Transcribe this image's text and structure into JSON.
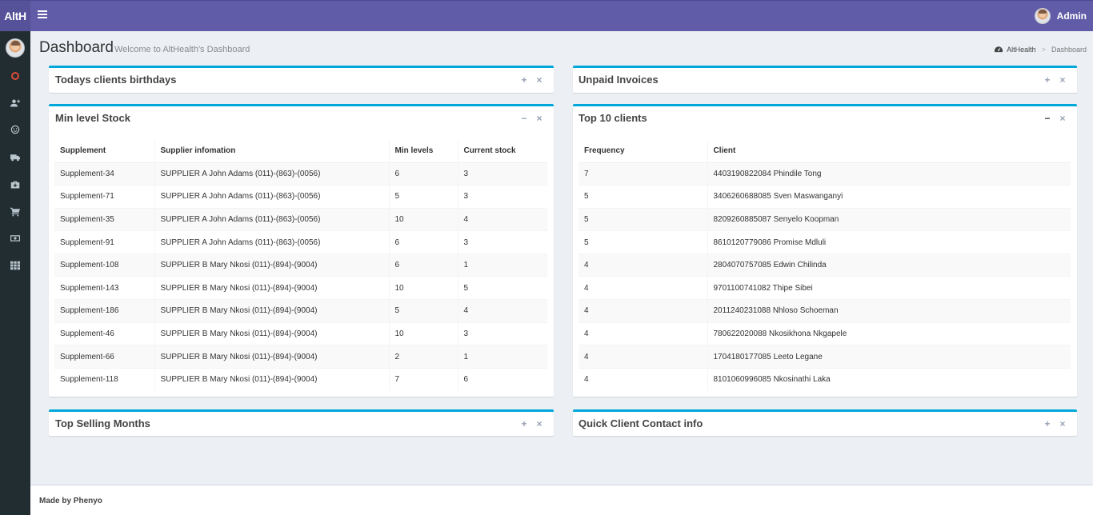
{
  "app": {
    "logo": "AltH",
    "user_name": "Admin"
  },
  "header": {
    "title": "Dashboard",
    "subtitle": "Welcome to AltHealth's Dashboard",
    "breadcrumb": {
      "home": "AltHealth",
      "current": "Dashboard"
    }
  },
  "sidebar": {
    "icons": [
      "circle-icon",
      "add-user-icon",
      "smile-icon",
      "truck-icon",
      "medkit-icon",
      "cart-icon",
      "money-icon",
      "grid-icon"
    ]
  },
  "boxes": {
    "birthdays": {
      "title": "Todays clients birthdays",
      "tool_expand": "+",
      "tool_close": "×"
    },
    "invoices": {
      "title": "Unpaid Invoices",
      "tool_expand": "+",
      "tool_close": "×"
    },
    "min_stock": {
      "title": "Min level Stock",
      "tool_collapse": "−",
      "tool_close": "×",
      "columns": [
        "Supplement",
        "Supplier infomation",
        "Min levels",
        "Current stock"
      ],
      "rows": [
        [
          "Supplement-34",
          "SUPPLIER A John Adams (011)-(863)-(0056)",
          "6",
          "3"
        ],
        [
          "Supplement-71",
          "SUPPLIER A John Adams (011)-(863)-(0056)",
          "5",
          "3"
        ],
        [
          "Supplement-35",
          "SUPPLIER A John Adams (011)-(863)-(0056)",
          "10",
          "4"
        ],
        [
          "Supplement-91",
          "SUPPLIER A John Adams (011)-(863)-(0056)",
          "6",
          "3"
        ],
        [
          "Supplement-108",
          "SUPPLIER B Mary Nkosi (011)-(894)-(9004)",
          "6",
          "1"
        ],
        [
          "Supplement-143",
          "SUPPLIER B Mary Nkosi (011)-(894)-(9004)",
          "10",
          "5"
        ],
        [
          "Supplement-186",
          "SUPPLIER B Mary Nkosi (011)-(894)-(9004)",
          "5",
          "4"
        ],
        [
          "Supplement-46",
          "SUPPLIER B Mary Nkosi (011)-(894)-(9004)",
          "10",
          "3"
        ],
        [
          "Supplement-66",
          "SUPPLIER B Mary Nkosi (011)-(894)-(9004)",
          "2",
          "1"
        ],
        [
          "Supplement-118",
          "SUPPLIER B Mary Nkosi (011)-(894)-(9004)",
          "7",
          "6"
        ]
      ]
    },
    "top_clients": {
      "title": "Top 10 clients",
      "tool_collapse": "−",
      "tool_close": "×",
      "columns": [
        "Frequency",
        "Client"
      ],
      "rows": [
        [
          "7",
          "4403190822084 Phindile Tong"
        ],
        [
          "5",
          "3406260688085 Sven Maswanganyi"
        ],
        [
          "5",
          "8209260885087 Senyelo Koopman"
        ],
        [
          "5",
          "8610120779086 Promise Mdluli"
        ],
        [
          "4",
          "2804070757085 Edwin Chilinda"
        ],
        [
          "4",
          "9701100741082 Thipe Sibei"
        ],
        [
          "4",
          "2011240231088 Nhloso Schoeman"
        ],
        [
          "4",
          "780622020088 Nkosikhona Nkgapele"
        ],
        [
          "4",
          "1704180177085 Leeto Legane"
        ],
        [
          "4",
          "8101060996085 Nkosinathi Laka"
        ]
      ]
    },
    "selling_months": {
      "title": "Top Selling Months",
      "tool_expand": "+",
      "tool_close": "×"
    },
    "contact_info": {
      "title": "Quick Client Contact info",
      "tool_expand": "+",
      "tool_close": "×"
    }
  },
  "footer": {
    "text": "Made by Phenyo"
  },
  "colors": {
    "topbar": "#605ca8",
    "sidebar": "#222d32",
    "box_accent": "#00a7d9"
  }
}
